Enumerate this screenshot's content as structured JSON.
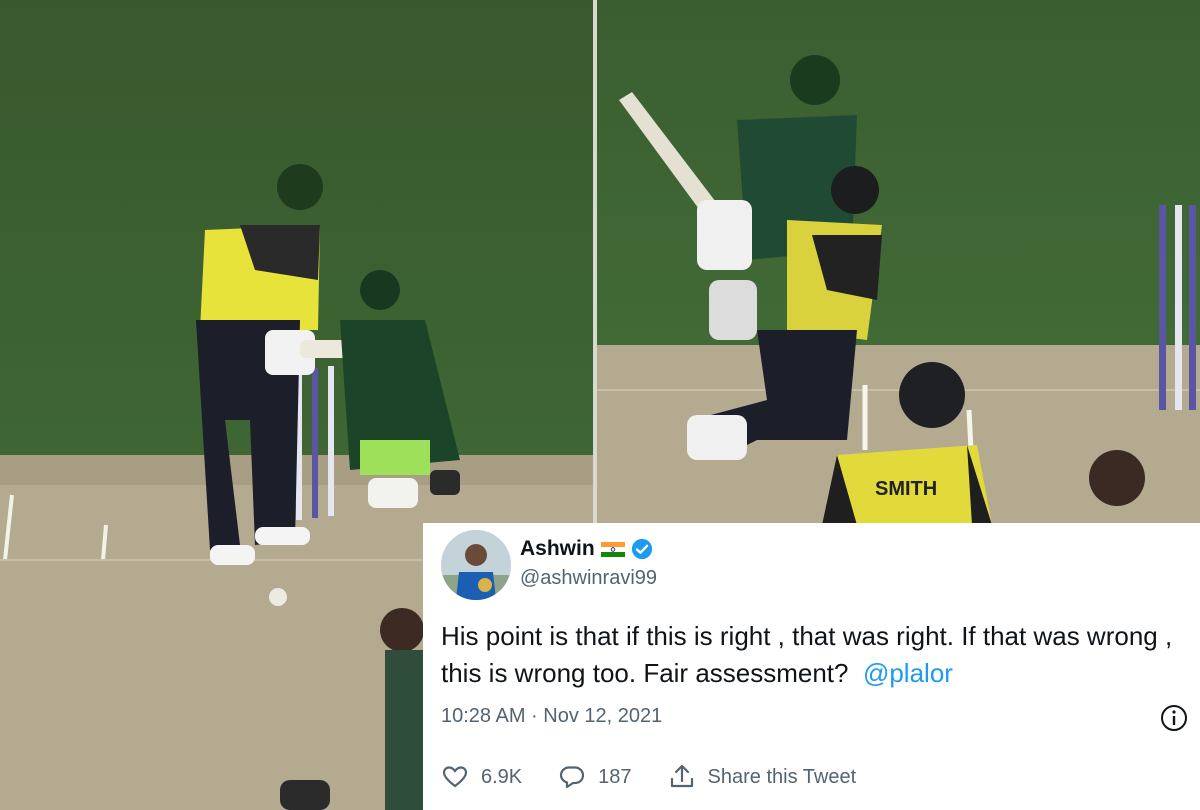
{
  "tweet": {
    "name": "Ashwin",
    "flag_icon": "india-flag-icon",
    "verified_icon": "verified-badge-icon",
    "handle": "@ashwinravi99",
    "text": "His point is that if this is right , that was right. If that was wrong , this is wrong too. Fair assessment?",
    "mention": "@plalor",
    "timestamp": "10:28 AM · Nov 12, 2021",
    "likes": "6.9K",
    "replies": "187",
    "share_label": "Share this Tweet",
    "colors": {
      "mention": "#1d9bf0",
      "verified": "#1d9bf0",
      "muted": "#536471"
    }
  },
  "scene": {
    "left_panel": "batsman-and-wicketkeeper-photo",
    "right_panel": "batsman-shot-with-smith-jersey-photo",
    "jersey_text": "SMITH"
  }
}
